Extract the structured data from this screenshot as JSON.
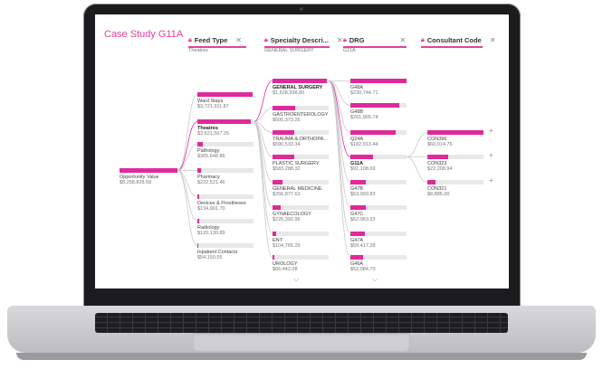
{
  "report": {
    "title": "Case Study G11A",
    "levels": [
      {
        "label": "Feed Type",
        "filter": "Theatres"
      },
      {
        "label": "Specialty Descri...",
        "filter": "GENERAL SURGERY"
      },
      {
        "label": "DRG",
        "filter": "G11A"
      },
      {
        "label": "Consultant Code",
        "filter": ""
      }
    ],
    "root": {
      "label": "Opportunity Value",
      "value": "$8,258,828.58",
      "fill": 1.0
    },
    "feed_types": [
      {
        "label": "Ward Stays",
        "value": "$3,721,911.87",
        "fill": 0.98,
        "selected": false
      },
      {
        "label": "Theatres",
        "value": "$3,621,567.25",
        "fill": 0.95,
        "selected": true
      },
      {
        "label": "Pathology",
        "value": "$365,648.86",
        "fill": 0.1,
        "selected": false
      },
      {
        "label": "Pharmacy",
        "value": "$222,521.46",
        "fill": 0.06,
        "selected": false
      },
      {
        "label": "Devices & Prostheses",
        "value": "$134,901.70",
        "fill": 0.04,
        "selected": false
      },
      {
        "label": "Radiology",
        "value": "$120,130.89",
        "fill": 0.03,
        "selected": false
      },
      {
        "label": "Inpatient Contacts",
        "value": "$54,150.55",
        "fill": 0.015,
        "selected": false
      }
    ],
    "specialties": [
      {
        "label": "GENERAL SURGERY",
        "value": "$1,528,938.80",
        "fill": 0.96,
        "selected": true
      },
      {
        "label": "GASTROENTEROLOGY",
        "value": "$606,373.26",
        "fill": 0.4,
        "selected": false
      },
      {
        "label": "TRAUMA & ORTHOPA...",
        "value": "$590,533.34",
        "fill": 0.39,
        "selected": false
      },
      {
        "label": "PLASTIC SURGERY",
        "value": "$583,288.32",
        "fill": 0.38,
        "selected": false
      },
      {
        "label": "GENERAL MEDICINE",
        "value": "$256,877.63",
        "fill": 0.17,
        "selected": false
      },
      {
        "label": "GYNAECOLOGY",
        "value": "$225,392.96",
        "fill": 0.15,
        "selected": false
      },
      {
        "label": "ENT",
        "value": "$104,765.29",
        "fill": 0.07,
        "selected": false
      },
      {
        "label": "UROLOGY",
        "value": "$66,442.08",
        "fill": 0.04,
        "selected": false
      }
    ],
    "drgs": [
      {
        "label": "G48A",
        "value": "$230,744.71",
        "fill": 1.0,
        "selected": false
      },
      {
        "label": "G48B",
        "value": "$201,965.74",
        "fill": 0.87,
        "selected": false
      },
      {
        "label": "Q24A",
        "value": "$182,913.44",
        "fill": 0.8,
        "selected": false
      },
      {
        "label": "G11A",
        "value": "$91,108.69",
        "fill": 0.4,
        "selected": true
      },
      {
        "label": "G47B",
        "value": "$63,969.83",
        "fill": 0.28,
        "selected": false
      },
      {
        "label": "G47C",
        "value": "$62,963.33",
        "fill": 0.27,
        "selected": false
      },
      {
        "label": "G47A",
        "value": "$59,417.28",
        "fill": 0.26,
        "selected": false
      },
      {
        "label": "G46A",
        "value": "$52,084.70",
        "fill": 0.23,
        "selected": false
      }
    ],
    "consultants": [
      {
        "label": "CON396",
        "value": "$60,014.75",
        "fill": 1.0
      },
      {
        "label": "CON323",
        "value": "$22,208.94",
        "fill": 0.37
      },
      {
        "label": "CON321",
        "value": "$8,885.00",
        "fill": 0.15
      }
    ],
    "colors": {
      "accent": "#e0299b",
      "track": "#e8e8e8"
    }
  }
}
